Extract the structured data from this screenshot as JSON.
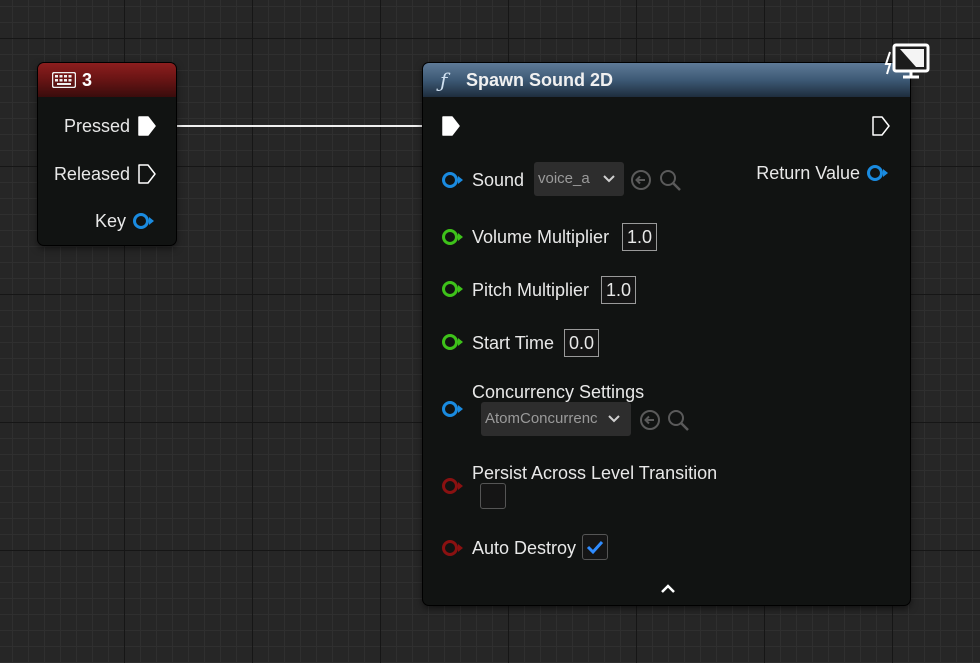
{
  "key_event_node": {
    "title": "3",
    "title_icon": "keyboard-icon",
    "pins": {
      "pressed": "Pressed",
      "released": "Released",
      "key": "Key"
    }
  },
  "spawn_node": {
    "title": "Spawn Sound 2D",
    "title_icon": "function-icon",
    "corner_icon": "client-only-monitor-icon",
    "inputs": {
      "sound_label": "Sound",
      "sound_value": "voice_a",
      "volume_label": "Volume Multiplier",
      "volume_value": "1.0",
      "pitch_label": "Pitch Multiplier",
      "pitch_value": "1.0",
      "start_label": "Start Time",
      "start_value": "0.0",
      "concurrency_label": "Concurrency Settings",
      "concurrency_value": "AtomConcurrenc",
      "persist_label": "Persist Across Level Transition",
      "persist_checked": false,
      "auto_label": "Auto Destroy",
      "auto_checked": true
    },
    "outputs": {
      "return_label": "Return Value"
    }
  },
  "colors": {
    "object_pin": "#1a8be0",
    "float_pin": "#3ec21a",
    "bool_pin": "#8a1111",
    "exec_pin": "#ffffff",
    "key_header": "#8c1e1e",
    "function_header": "#4b6a88",
    "checkmark": "#2f8cff"
  }
}
